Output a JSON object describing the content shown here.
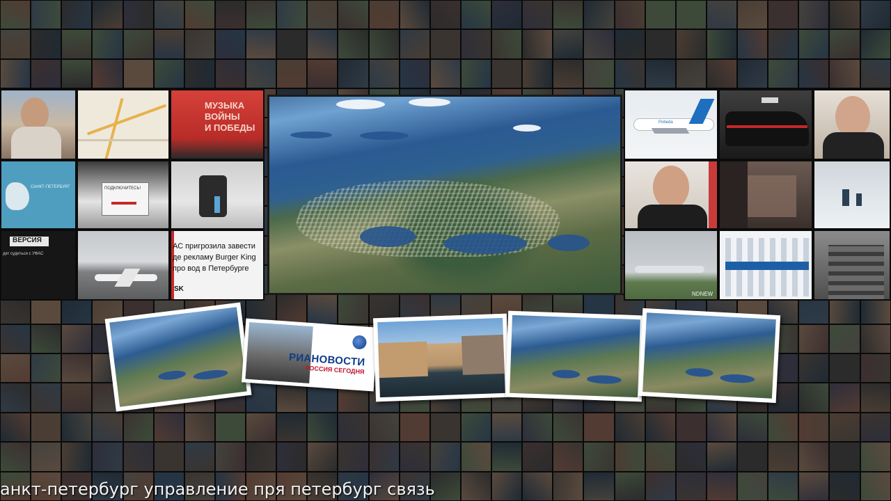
{
  "ticker": {
    "text": "анкт-петербург управление пря петербург связь"
  },
  "left_panels": {
    "music_banner": {
      "line1": "МУЗЫКА",
      "line2": "ВОЙНЫ",
      "line3": "И ПОБЕДЫ"
    },
    "sign_text": "ПОДКЛЮЧИТЕСЬ!",
    "map_text": "САНКТ-ПЕТЕРБУРГ",
    "versiya": {
      "logo": "ВЕРСИЯ",
      "text": "дет судиться с УФАС"
    },
    "headline": "АС пригрозила завести де рекламу Burger King про вод в Петербурге",
    "headline_suffix": "SK"
  },
  "right_panels": {
    "watermark": "NDNEW",
    "plane_brand": "Pobeda"
  },
  "polaroids": {
    "ria_name": "РИАНОВОСТИ",
    "ria_sub": "РОССИЯ СЕГОДНЯ"
  },
  "colors": {
    "background": "#111111",
    "ria_blue": "#0d3d8a",
    "ria_red": "#c0142a",
    "music_red": "#c9302c"
  }
}
